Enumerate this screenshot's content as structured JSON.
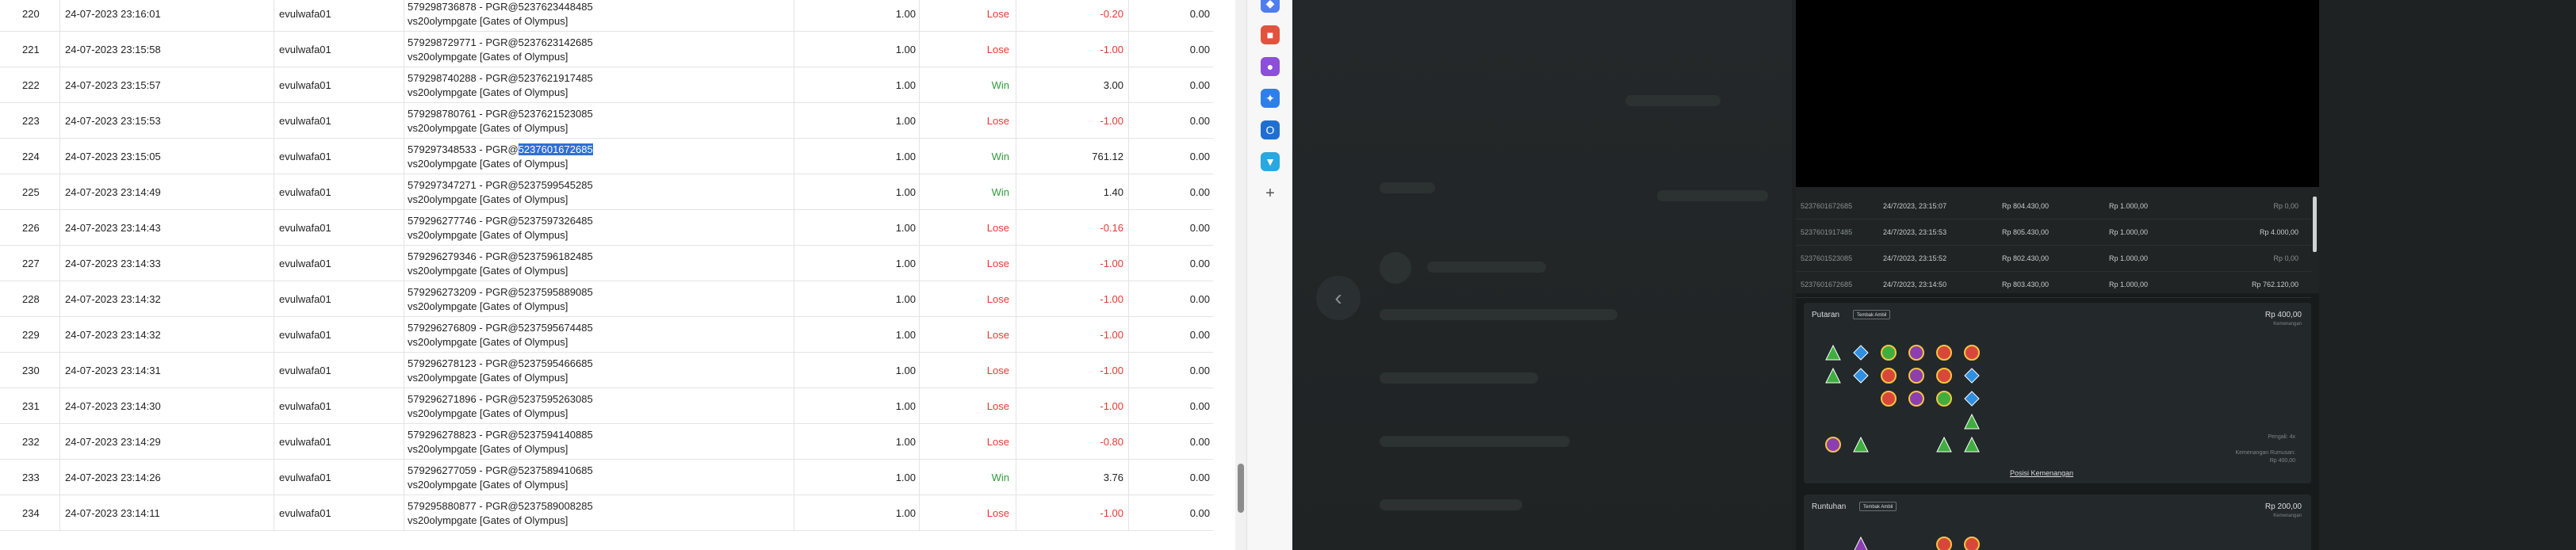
{
  "transactions": [
    {
      "no": "220",
      "date": "24-07-2023 23:16:01",
      "user": "evulwafa01",
      "ref": "579298736878 - PGR@5237623448485",
      "game": "vs20olympgate [Gates of Olympus]",
      "bet": "1.00",
      "status": "Lose",
      "win": "-0.20",
      "jackpot": "0.00"
    },
    {
      "no": "221",
      "date": "24-07-2023 23:15:58",
      "user": "evulwafa01",
      "ref": "579298729771 - PGR@5237623142685",
      "game": "vs20olympgate [Gates of Olympus]",
      "bet": "1.00",
      "status": "Lose",
      "win": "-1.00",
      "jackpot": "0.00"
    },
    {
      "no": "222",
      "date": "24-07-2023 23:15:57",
      "user": "evulwafa01",
      "ref": "579298740288 - PGR@5237621917485",
      "game": "vs20olympgate [Gates of Olympus]",
      "bet": "1.00",
      "status": "Win",
      "win": "3.00",
      "jackpot": "0.00"
    },
    {
      "no": "223",
      "date": "24-07-2023 23:15:53",
      "user": "evulwafa01",
      "ref": "579298780761 - PGR@5237621523085",
      "game": "vs20olympgate [Gates of Olympus]",
      "bet": "1.00",
      "status": "Lose",
      "win": "-1.00",
      "jackpot": "0.00"
    },
    {
      "no": "224",
      "date": "24-07-2023 23:15:05",
      "user": "evulwafa01",
      "ref_prefix": "579297348533 - PGR@",
      "ref_highlight": "5237601672685",
      "game": "vs20olympgate [Gates of Olympus]",
      "bet": "1.00",
      "status": "Win",
      "win": "761.12",
      "jackpot": "0.00"
    },
    {
      "no": "225",
      "date": "24-07-2023 23:14:49",
      "user": "evulwafa01",
      "ref": "579297347271 - PGR@5237599545285",
      "game": "vs20olympgate [Gates of Olympus]",
      "bet": "1.00",
      "status": "Win",
      "win": "1.40",
      "jackpot": "0.00"
    },
    {
      "no": "226",
      "date": "24-07-2023 23:14:43",
      "user": "evulwafa01",
      "ref": "579296277746 - PGR@5237597326485",
      "game": "vs20olympgate [Gates of Olympus]",
      "bet": "1.00",
      "status": "Lose",
      "win": "-0.16",
      "jackpot": "0.00"
    },
    {
      "no": "227",
      "date": "24-07-2023 23:14:33",
      "user": "evulwafa01",
      "ref": "579296279346 - PGR@5237596182485",
      "game": "vs20olympgate [Gates of Olympus]",
      "bet": "1.00",
      "status": "Lose",
      "win": "-1.00",
      "jackpot": "0.00"
    },
    {
      "no": "228",
      "date": "24-07-2023 23:14:32",
      "user": "evulwafa01",
      "ref": "579296273209 - PGR@5237595889085",
      "game": "vs20olympgate [Gates of Olympus]",
      "bet": "1.00",
      "status": "Lose",
      "win": "-1.00",
      "jackpot": "0.00"
    },
    {
      "no": "229",
      "date": "24-07-2023 23:14:32",
      "user": "evulwafa01",
      "ref": "579296276809 - PGR@5237595674485",
      "game": "vs20olympgate [Gates of Olympus]",
      "bet": "1.00",
      "status": "Lose",
      "win": "-1.00",
      "jackpot": "0.00"
    },
    {
      "no": "230",
      "date": "24-07-2023 23:14:31",
      "user": "evulwafa01",
      "ref": "579296278123 - PGR@5237595466685",
      "game": "vs20olympgate [Gates of Olympus]",
      "bet": "1.00",
      "status": "Lose",
      "win": "-1.00",
      "jackpot": "0.00"
    },
    {
      "no": "231",
      "date": "24-07-2023 23:14:30",
      "user": "evulwafa01",
      "ref": "579296271896 - PGR@5237595263085",
      "game": "vs20olympgate [Gates of Olympus]",
      "bet": "1.00",
      "status": "Lose",
      "win": "-1.00",
      "jackpot": "0.00"
    },
    {
      "no": "232",
      "date": "24-07-2023 23:14:29",
      "user": "evulwafa01",
      "ref": "579296278823 - PGR@5237594140885",
      "game": "vs20olympgate [Gates of Olympus]",
      "bet": "1.00",
      "status": "Lose",
      "win": "-0.80",
      "jackpot": "0.00"
    },
    {
      "no": "233",
      "date": "24-07-2023 23:14:26",
      "user": "evulwafa01",
      "ref": "579296277059 - PGR@5237589410685",
      "game": "vs20olympgate [Gates of Olympus]",
      "bet": "1.00",
      "status": "Win",
      "win": "3.76",
      "jackpot": "0.00"
    },
    {
      "no": "234",
      "date": "24-07-2023 23:14:11",
      "user": "evulwafa01",
      "ref": "579295880877 - PGR@5237589008285",
      "game": "vs20olympgate [Gates of Olympus]",
      "bet": "1.00",
      "status": "Lose",
      "win": "-1.00",
      "jackpot": "0.00"
    }
  ],
  "sidebar": {
    "icons": [
      {
        "name": "diamond-icon",
        "color": "#4f7df0",
        "glyph": "◆"
      },
      {
        "name": "toolbox-icon",
        "color": "#e0533d",
        "glyph": "■"
      },
      {
        "name": "person-icon",
        "color": "#8b4fd9",
        "glyph": "●"
      },
      {
        "name": "copilot-icon",
        "color": "#2f7fe8",
        "glyph": "✦"
      },
      {
        "name": "outlook-icon",
        "color": "#1f6fcf",
        "glyph": "O"
      },
      {
        "name": "shopping-icon",
        "color": "#2aa8e0",
        "glyph": "▼"
      }
    ],
    "add_glyph": "+"
  },
  "game_history": {
    "rows": [
      {
        "id": "5237601672685",
        "date": "24/7/2023, 23:15:07",
        "balance": "Rp 804.430,00",
        "bet": "Rp 1.000,00",
        "win": "Rp 0,00"
      },
      {
        "id": "5237601917485",
        "date": "24/7/2023, 23:15:53",
        "balance": "Rp 805.430,00",
        "bet": "Rp 1.000,00",
        "win": "Rp 4.000,00"
      },
      {
        "id": "5237601523085",
        "date": "24/7/2023, 23:15:52",
        "balance": "Rp 802.430,00",
        "bet": "Rp 1.000,00",
        "win": "Rp 0,00"
      },
      {
        "id": "5237601672685",
        "date": "24/7/2023, 23:14:50",
        "balance": "Rp 803.430,00",
        "bet": "Rp 1.000,00",
        "win": "Rp 762.120,00"
      }
    ],
    "round1": {
      "title": "Putaran",
      "badge": "Tembak Ambil",
      "amount": "Rp 400,00",
      "sub": "Kemenangan",
      "note1": "Pengali: 4x",
      "note2": "Kemenangan Rumusan:",
      "note3": "Rp 400,00",
      "link": "Posisi Kemenangan"
    },
    "round2": {
      "title": "Runtuhan",
      "badge": "Tembak Ambil",
      "amount": "Rp 200,00",
      "sub": "Kemenangan"
    },
    "back_glyph": "‹",
    "colors": {
      "bg": "#1f2223",
      "panel": "#181b1c",
      "card": "#23282a"
    }
  }
}
